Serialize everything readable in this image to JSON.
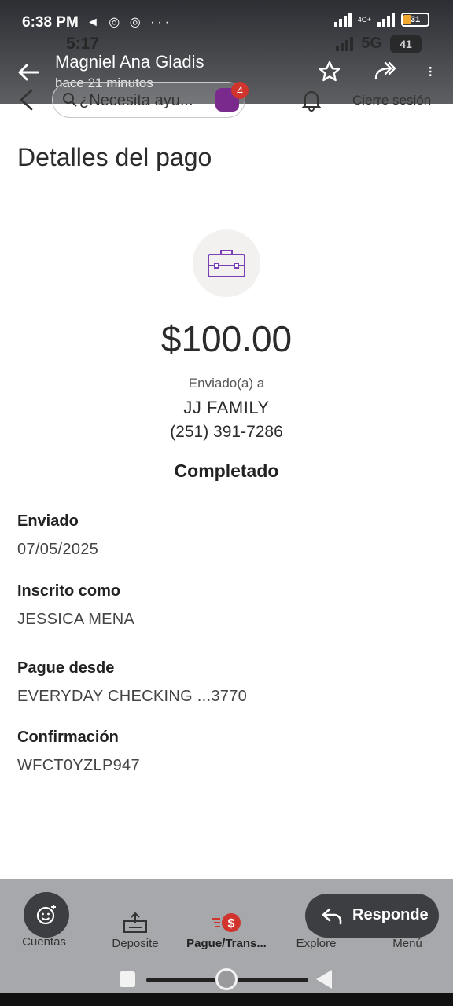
{
  "viewer": {
    "status_time": "6:38 PM",
    "status_icons": "◄ ◎ ◎ ···",
    "network_label": "4G+",
    "battery": "31",
    "contact_name": "Magniel Ana Gladis",
    "sent_ago": "hace 21 minutos",
    "reply_label": "Responde"
  },
  "phone_status": {
    "time": "5:17",
    "network": "5G",
    "battery": "41"
  },
  "app_header": {
    "search_placeholder": "¿Necesita ayu...",
    "chat_badge_count": "4",
    "logout_label": "Cierre sesión"
  },
  "payment": {
    "page_title": "Detalles del pago",
    "amount": "$100.00",
    "sent_to_label": "Enviado(a) a",
    "payee": "JJ FAMILY",
    "payee_phone": "(251) 391-7286",
    "status": "Completado",
    "details": [
      {
        "label": "Enviado",
        "value": "07/05/2025"
      },
      {
        "label": "Inscrito como",
        "value": "JESSICA MENA"
      },
      {
        "label": "Pague desde",
        "value": "EVERYDAY CHECKING ...3770"
      },
      {
        "label": "Confirmación",
        "value": "WFCT0YZLP947"
      }
    ]
  },
  "bottom_nav": {
    "items": [
      {
        "label": "Cuentas",
        "icon": "accounts-icon"
      },
      {
        "label": "Deposite",
        "icon": "deposit-icon"
      },
      {
        "label": "Pague/Trans...",
        "icon": "pay-transfer-icon",
        "active": true
      },
      {
        "label": "Explore",
        "icon": "compass-icon"
      },
      {
        "label": "Menú",
        "icon": "menu-icon"
      }
    ]
  },
  "colors": {
    "accent_purple": "#7a3fb5",
    "pay_red": "#d0342c"
  }
}
